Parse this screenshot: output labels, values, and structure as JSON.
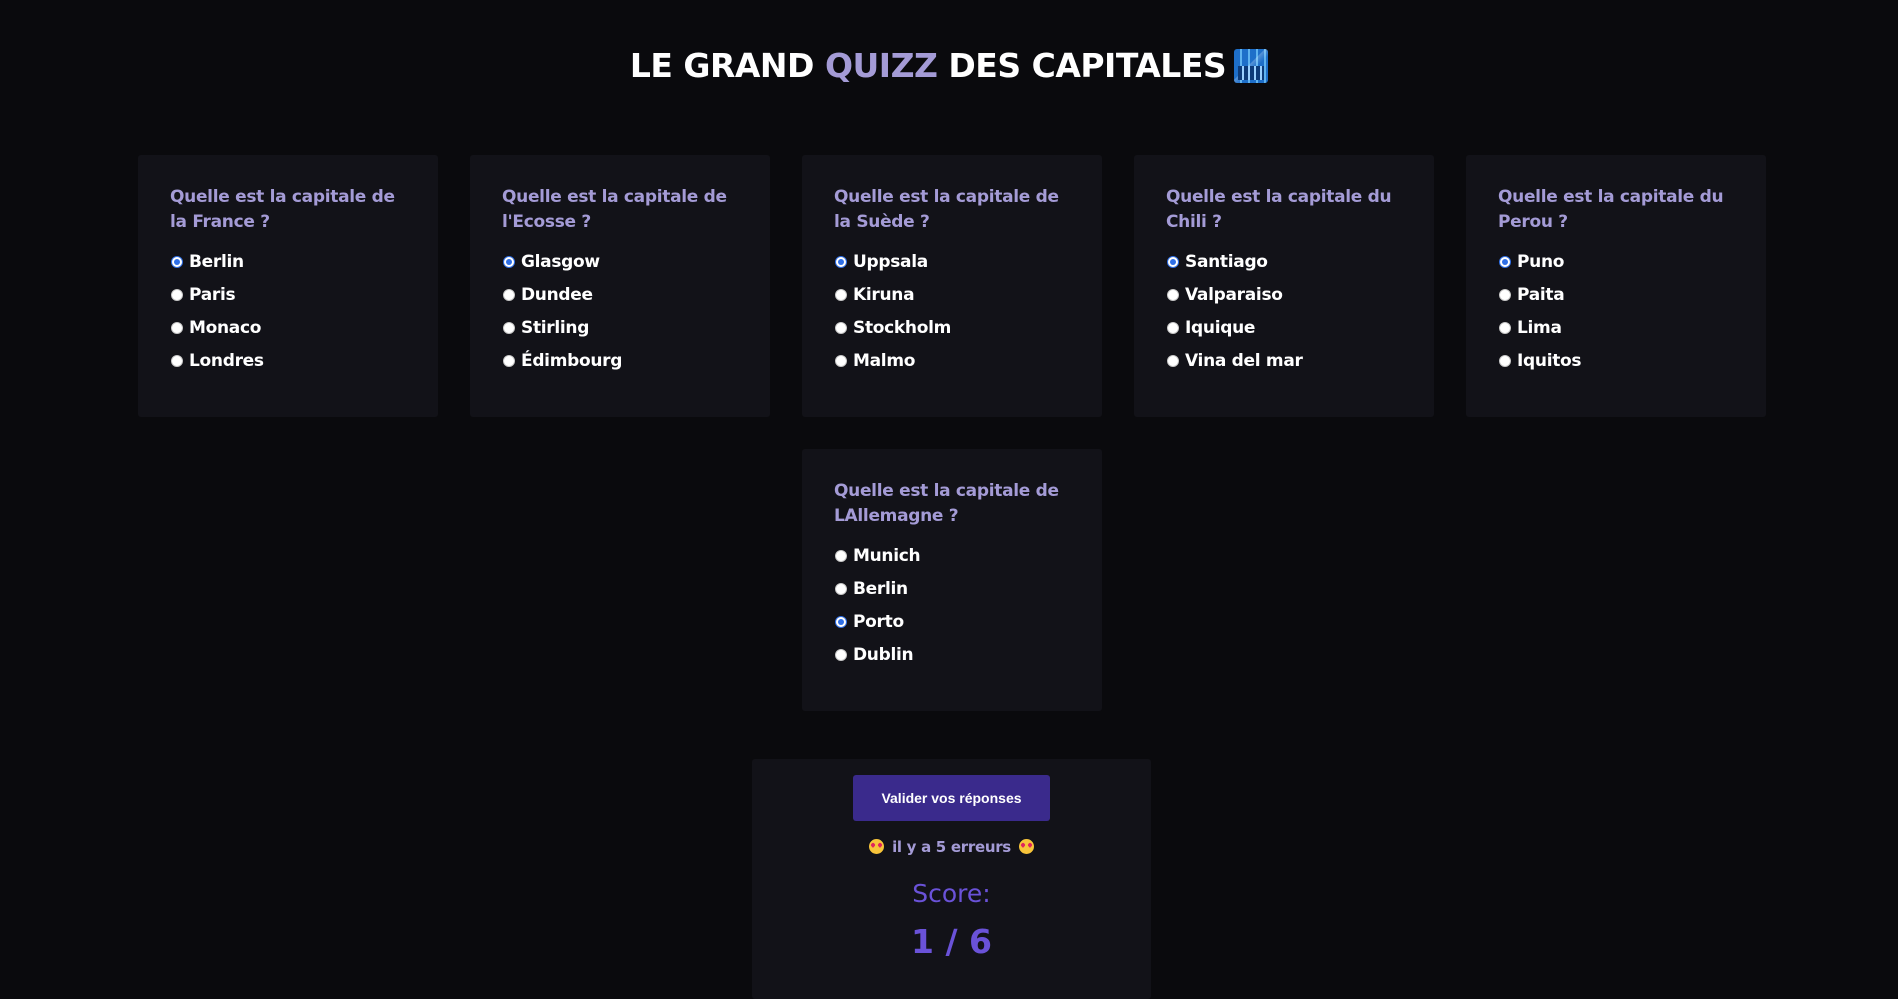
{
  "header": {
    "title_part1": "LE GRAND ",
    "title_accent": "QUIZZ",
    "title_part2": " DES CAPITALES",
    "title_emoji": "cityscape-icon"
  },
  "questions": [
    {
      "question": "Quelle est la capitale de la France ?",
      "options": [
        "Berlin",
        "Paris",
        "Monaco",
        "Londres"
      ],
      "selected": 0
    },
    {
      "question": "Quelle est la capitale de l'Ecosse ?",
      "options": [
        "Glasgow",
        "Dundee",
        "Stirling",
        "Édimbourg"
      ],
      "selected": 0
    },
    {
      "question": "Quelle est la capitale de la Suède ?",
      "options": [
        "Uppsala",
        "Kiruna",
        "Stockholm",
        "Malmo"
      ],
      "selected": 0
    },
    {
      "question": "Quelle est la capitale du Chili ?",
      "options": [
        "Santiago",
        "Valparaiso",
        "Iquique",
        "Vina del mar"
      ],
      "selected": 0
    },
    {
      "question": "Quelle est la capitale du Perou ?",
      "options": [
        "Puno",
        "Paita",
        "Lima",
        "Iquitos"
      ],
      "selected": 0
    },
    {
      "question": "Quelle est la capitale de LAllemagne ?",
      "options": [
        "Munich",
        "Berlin",
        "Porto",
        "Dublin"
      ],
      "selected": 2
    }
  ],
  "result": {
    "validate_label": "Valider vos réponses",
    "errors_text": "il y a 5 erreurs",
    "score_label": "Score:",
    "score_value": "1 / 6"
  },
  "colors": {
    "background": "#0a0a0d",
    "card": "#121218",
    "accent": "#a49bd6",
    "button": "#3a2a8c",
    "score": "#6a52d8",
    "radio_checked": "#2f6fe6"
  }
}
